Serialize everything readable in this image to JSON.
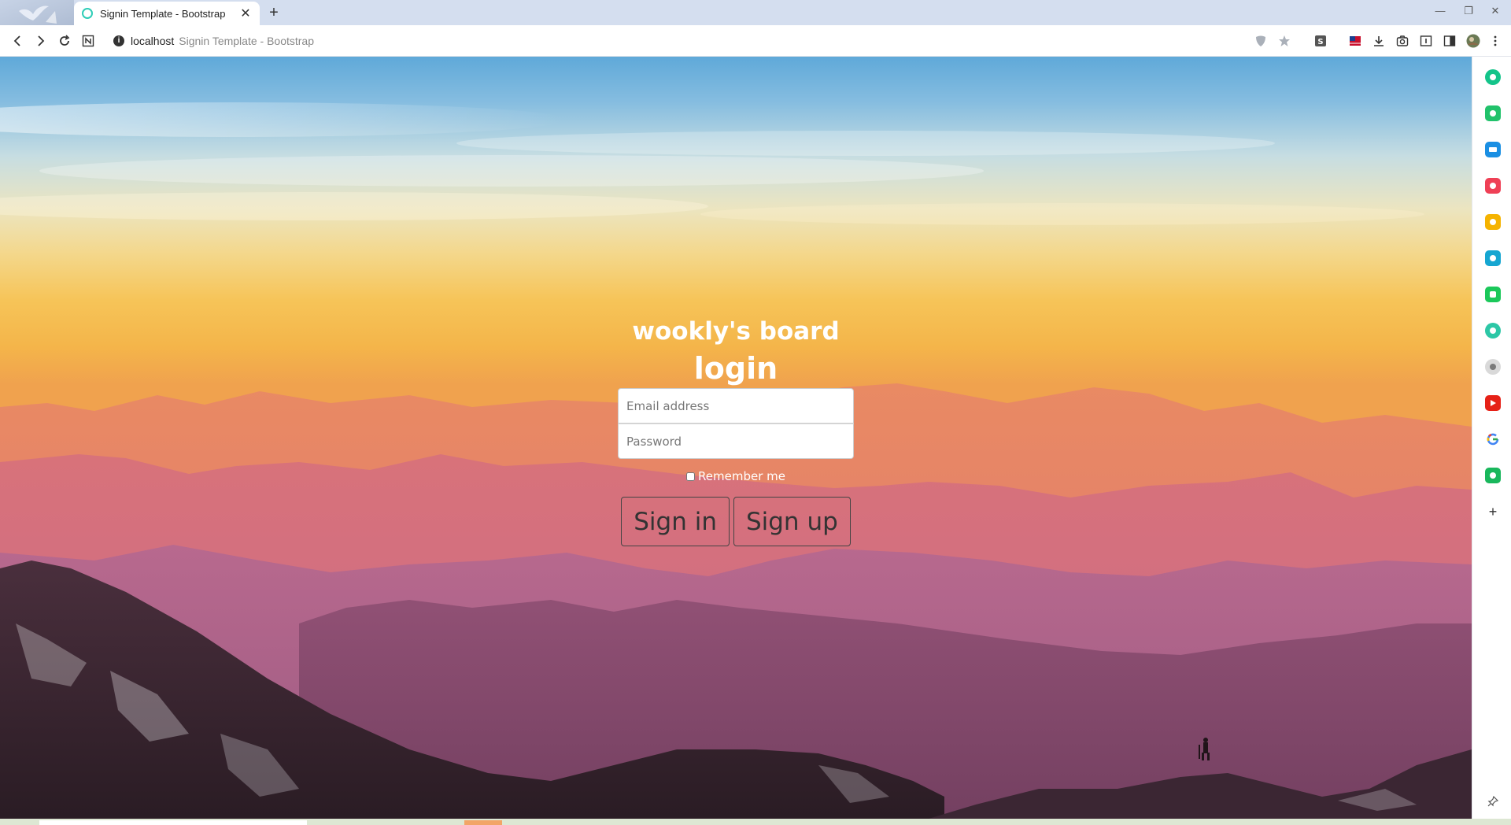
{
  "browser": {
    "tab_title": "Signin Template - Bootstrap",
    "tab_close": "✕",
    "new_tab": "+",
    "window_controls": {
      "minimize": "—",
      "restore": "❐",
      "close": "✕"
    },
    "url_host": "localhost",
    "url_title": "Signin Template - Bootstrap"
  },
  "page": {
    "brand": "wookly's board",
    "heading": "login",
    "email_placeholder": "Email address",
    "password_placeholder": "Password",
    "remember_label": "Remember me",
    "signin_label": "Sign in",
    "signup_label": "Sign up"
  },
  "sidebar": {
    "add": "+",
    "apps": [
      {
        "name": "whale-app",
        "color": "#14c48a"
      },
      {
        "name": "notes-app",
        "color": "#21c26b"
      },
      {
        "name": "calendar-app",
        "color": "#1a8fe3"
      },
      {
        "name": "pocket-app",
        "color": "#ef4056"
      },
      {
        "name": "favorites-app",
        "color": "#f5b300"
      },
      {
        "name": "translate-app",
        "color": "#16a6d1"
      },
      {
        "name": "line-app",
        "color": "#1bc85a"
      },
      {
        "name": "player-app",
        "color": "#2cc7a6"
      },
      {
        "name": "papago-app",
        "color": "#7a7a7a"
      },
      {
        "name": "youtube-app",
        "color": "#e62117"
      },
      {
        "name": "google-app",
        "color": "#4285f4"
      },
      {
        "name": "map-app",
        "color": "#19b75c"
      }
    ]
  }
}
